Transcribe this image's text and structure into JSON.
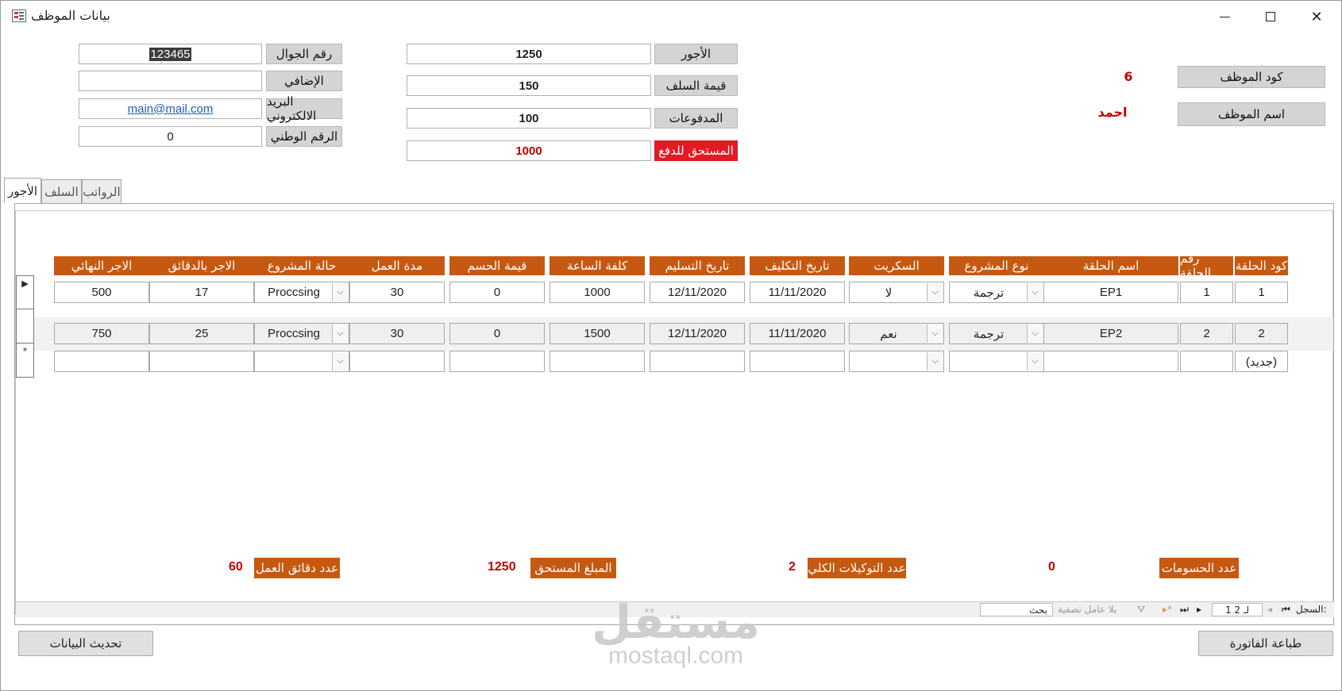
{
  "window": {
    "title": "بيانات الموظف"
  },
  "contact": {
    "mobile_label": "رقم الجوال",
    "mobile_value": "123465",
    "extra_label": "الإضافي",
    "extra_value": "",
    "email_label": "البريد الالكتروني",
    "email_value": "main@mail.com",
    "national_id_label": "الرقم الوطني",
    "national_id_value": "0"
  },
  "finance": {
    "wages_label": "الأجور",
    "wages_value": "1250",
    "advances_label": "قيمة  السلف",
    "advances_value": "150",
    "payments_label": "المدفوعات",
    "payments_value": "100",
    "due_label": "المستحق للدفع",
    "due_value": "1000"
  },
  "employee": {
    "code_label": "كود الموظف",
    "code_value": "6",
    "name_label": "اسم الموظف",
    "name_value": "احمد"
  },
  "tabs": [
    {
      "label": "الرواتب"
    },
    {
      "label": "السلف"
    },
    {
      "label": "الأجور"
    }
  ],
  "table": {
    "headers": {
      "ep_code": "كود الحلقة",
      "ep_num": "رقم الحلقة",
      "ep_name": "اسم الحلقة",
      "project_type": "نوع المشروع",
      "script": "السكريت",
      "assign_date": "تاريخ التكليف",
      "delivery_date": "تاريخ التسليم",
      "hour_cost": "كلفة الساعة",
      "deduction": "قيمة الحسم",
      "duration": "مدة العمل",
      "status": "حالة المشروع",
      "minute_wage": "الاجر بالدقائق",
      "final_wage": "الاجر النهائي"
    },
    "rows": [
      {
        "ep_code": "1",
        "ep_num": "1",
        "ep_name": "EP1",
        "project_type": "ترجمة",
        "script": "لا",
        "assign_date": "11/11/2020",
        "delivery_date": "12/11/2020",
        "hour_cost": "1000",
        "deduction": "0",
        "duration": "30",
        "status": "Proccsing",
        "minute_wage": "17",
        "final_wage": "500"
      },
      {
        "ep_code": "2",
        "ep_num": "2",
        "ep_name": "EP2",
        "project_type": "ترجمة",
        "script": "نعم",
        "assign_date": "11/11/2020",
        "delivery_date": "12/11/2020",
        "hour_cost": "1500",
        "deduction": "0",
        "duration": "30",
        "status": "Proccsing",
        "minute_wage": "25",
        "final_wage": "750"
      }
    ],
    "new_row": {
      "ep_code": "(جديد)",
      "selector": "*"
    }
  },
  "summary": {
    "deductions_count_label": "عدد الحسومات",
    "deductions_count_value": "0",
    "assignments_total_label": "عدد التوكيلات الكلي",
    "assignments_total_value": "2",
    "amount_due_label": "المبلغ المستحق",
    "amount_due_value": "1250",
    "work_minutes_label": "عدد دقائق العمل",
    "work_minutes_value": "60"
  },
  "nav": {
    "record_label": "السجل:",
    "record_position": "1 لـ 2",
    "filter_label": "بلا عامل تصفية",
    "search_label": "بحث"
  },
  "buttons": {
    "print_invoice": "طباعة الفاتورة",
    "refresh_data": "تحديث البيانات"
  },
  "watermark": {
    "logo": "مستقل",
    "url": "mostaql.com"
  }
}
